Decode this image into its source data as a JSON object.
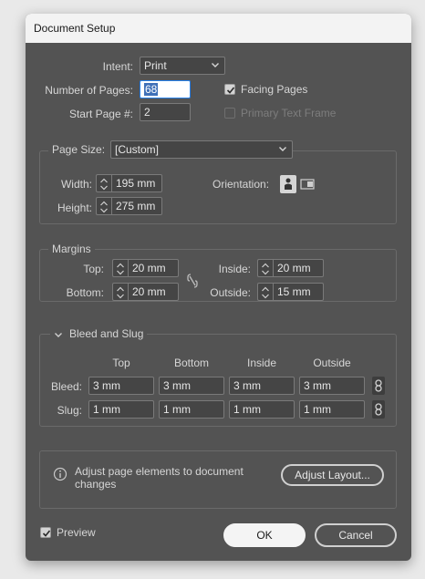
{
  "window": {
    "title": "Document Setup"
  },
  "setup": {
    "intent_label": "Intent:",
    "intent_value": "Print",
    "pages_label": "Number of Pages:",
    "pages_value": "68",
    "start_label": "Start Page #:",
    "start_value": "2",
    "facing_label": "Facing Pages",
    "facing_checked": true,
    "primary_label": "Primary Text Frame",
    "primary_checked": false
  },
  "page_size": {
    "label": "Page Size:",
    "value": "[Custom]",
    "width_label": "Width:",
    "width_value": "195 mm",
    "height_label": "Height:",
    "height_value": "275 mm",
    "orientation_label": "Orientation:"
  },
  "margins": {
    "title": "Margins",
    "top_label": "Top:",
    "top_value": "20 mm",
    "bottom_label": "Bottom:",
    "bottom_value": "20 mm",
    "inside_label": "Inside:",
    "inside_value": "20 mm",
    "outside_label": "Outside:",
    "outside_value": "15 mm"
  },
  "bleed_slug": {
    "title": "Bleed and Slug",
    "headers": [
      "Top",
      "Bottom",
      "Inside",
      "Outside"
    ],
    "bleed_label": "Bleed:",
    "bleed": [
      "3 mm",
      "3 mm",
      "3 mm",
      "3 mm"
    ],
    "slug_label": "Slug:",
    "slug": [
      "1 mm",
      "1 mm",
      "1 mm",
      "1 mm"
    ]
  },
  "adjust": {
    "text": "Adjust page elements to document changes",
    "button": "Adjust Layout..."
  },
  "footer": {
    "preview_label": "Preview",
    "preview_checked": true,
    "ok": "OK",
    "cancel": "Cancel"
  },
  "icons": [
    "chevron-down-icon",
    "checkmark-icon",
    "portrait-icon",
    "landscape-icon",
    "link-icon",
    "info-icon",
    "stepper-icon",
    "collapse-chevron-icon"
  ],
  "colors": {
    "dialog_bg": "#535353",
    "accent": "#2680eb",
    "selection": "#3f70b8"
  }
}
